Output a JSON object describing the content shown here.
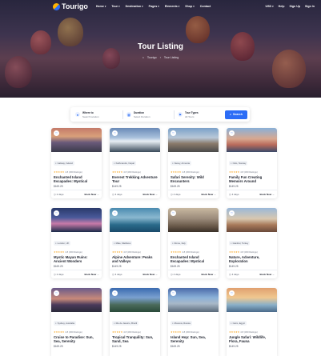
{
  "brand": {
    "name": "Tourigo"
  },
  "nav": [
    {
      "label": "Home"
    },
    {
      "label": "Tour"
    },
    {
      "label": "Destination"
    },
    {
      "label": "Pages"
    },
    {
      "label": "Elements"
    },
    {
      "label": "Shop"
    },
    {
      "label": "Contact"
    }
  ],
  "nav_right": {
    "currency": "USD",
    "help": "Help",
    "signup": "Sign Up",
    "signin": "Sign In"
  },
  "hero": {
    "title": "Tour Listing",
    "crumb_home": "Tourigo",
    "crumb_current": "Tour Listing"
  },
  "search": {
    "where_label": "Where to",
    "where_value": "Search location",
    "duration_label": "Duration",
    "duration_value": "Select Duration",
    "type_label": "Tour Types",
    "type_value": "All Tours",
    "button": "Search"
  },
  "colors": {
    "accent": "#2c6df6",
    "star": "#f5a623"
  },
  "tours": [
    {
      "location": "Galway, Ireland",
      "rating": "4.8 (300 Ratings)",
      "title": "Enchanted Island Escapades: Mystical",
      "price": "$169.25",
      "days": "2 days",
      "cta": "Book Now"
    },
    {
      "location": "Kathmandu, Nepal",
      "rating": "4.8 (300 Ratings)",
      "title": "Everest Trekking Adventure Tour",
      "price": "$149.25",
      "days": "4 days",
      "cta": "Book Now"
    },
    {
      "location": "Nessy, Armenia",
      "rating": "4.8 (300 Ratings)",
      "title": "Safari Serenity: Wild Encounters",
      "price": "$169.25",
      "days": "4 days",
      "cta": "Book Now"
    },
    {
      "location": "Oslo, Norway",
      "rating": "4.8 (300 Ratings)",
      "title": "Family Fun Creating Memoirs Around",
      "price": "$149.25",
      "days": "4 days",
      "cta": "Book Now"
    },
    {
      "location": "London, UK",
      "rating": "4.8 (300 Ratings)",
      "title": "Mystic Mayan Ruins: Ancient Wonders",
      "price": "$169.25",
      "days": "2 days",
      "cta": "Book Now"
    },
    {
      "location": "Male, Maldives",
      "rating": "4.8 (300 Ratings)",
      "title": "Alpine Adventure: Peaks and Valleys",
      "price": "$149.25",
      "days": "4 days",
      "cta": "Book Now"
    },
    {
      "location": "Rome, Italy",
      "rating": "4.8 (300 Ratings)",
      "title": "Enchanted Island Escapades: Mystical",
      "price": "$169.25",
      "days": "4 days",
      "cta": "Book Now"
    },
    {
      "location": "Istanbul, Turkey",
      "rating": "4.8 (300 Ratings)",
      "title": "Nature, Adventure, Exploration",
      "price": "$149.25",
      "days": "4 days",
      "cta": "Book Now"
    },
    {
      "location": "Sydney, Australia",
      "rating": "4.8 (300 Ratings)",
      "title": "Cruise to Paradise: Sun, Sea, Serenity",
      "price": "$169.25",
      "days": "",
      "cta": ""
    },
    {
      "location": "Rio de Janeiro, Brazil",
      "rating": "4.8 (300 Ratings)",
      "title": "Tropical Tranquility: Sun, Sand, Sea",
      "price": "$149.25",
      "days": "",
      "cta": ""
    },
    {
      "location": "Moscow, Russia",
      "rating": "4.8 (300 Ratings)",
      "title": "Island Hop: Sun, Sea, Serenity",
      "price": "$169.25",
      "days": "",
      "cta": ""
    },
    {
      "location": "Cairo, Egypt",
      "rating": "4.8 (300 Ratings)",
      "title": "Jungle Safari: Wildlife, Flora, Fauna",
      "price": "$149.25",
      "days": "",
      "cta": ""
    }
  ]
}
